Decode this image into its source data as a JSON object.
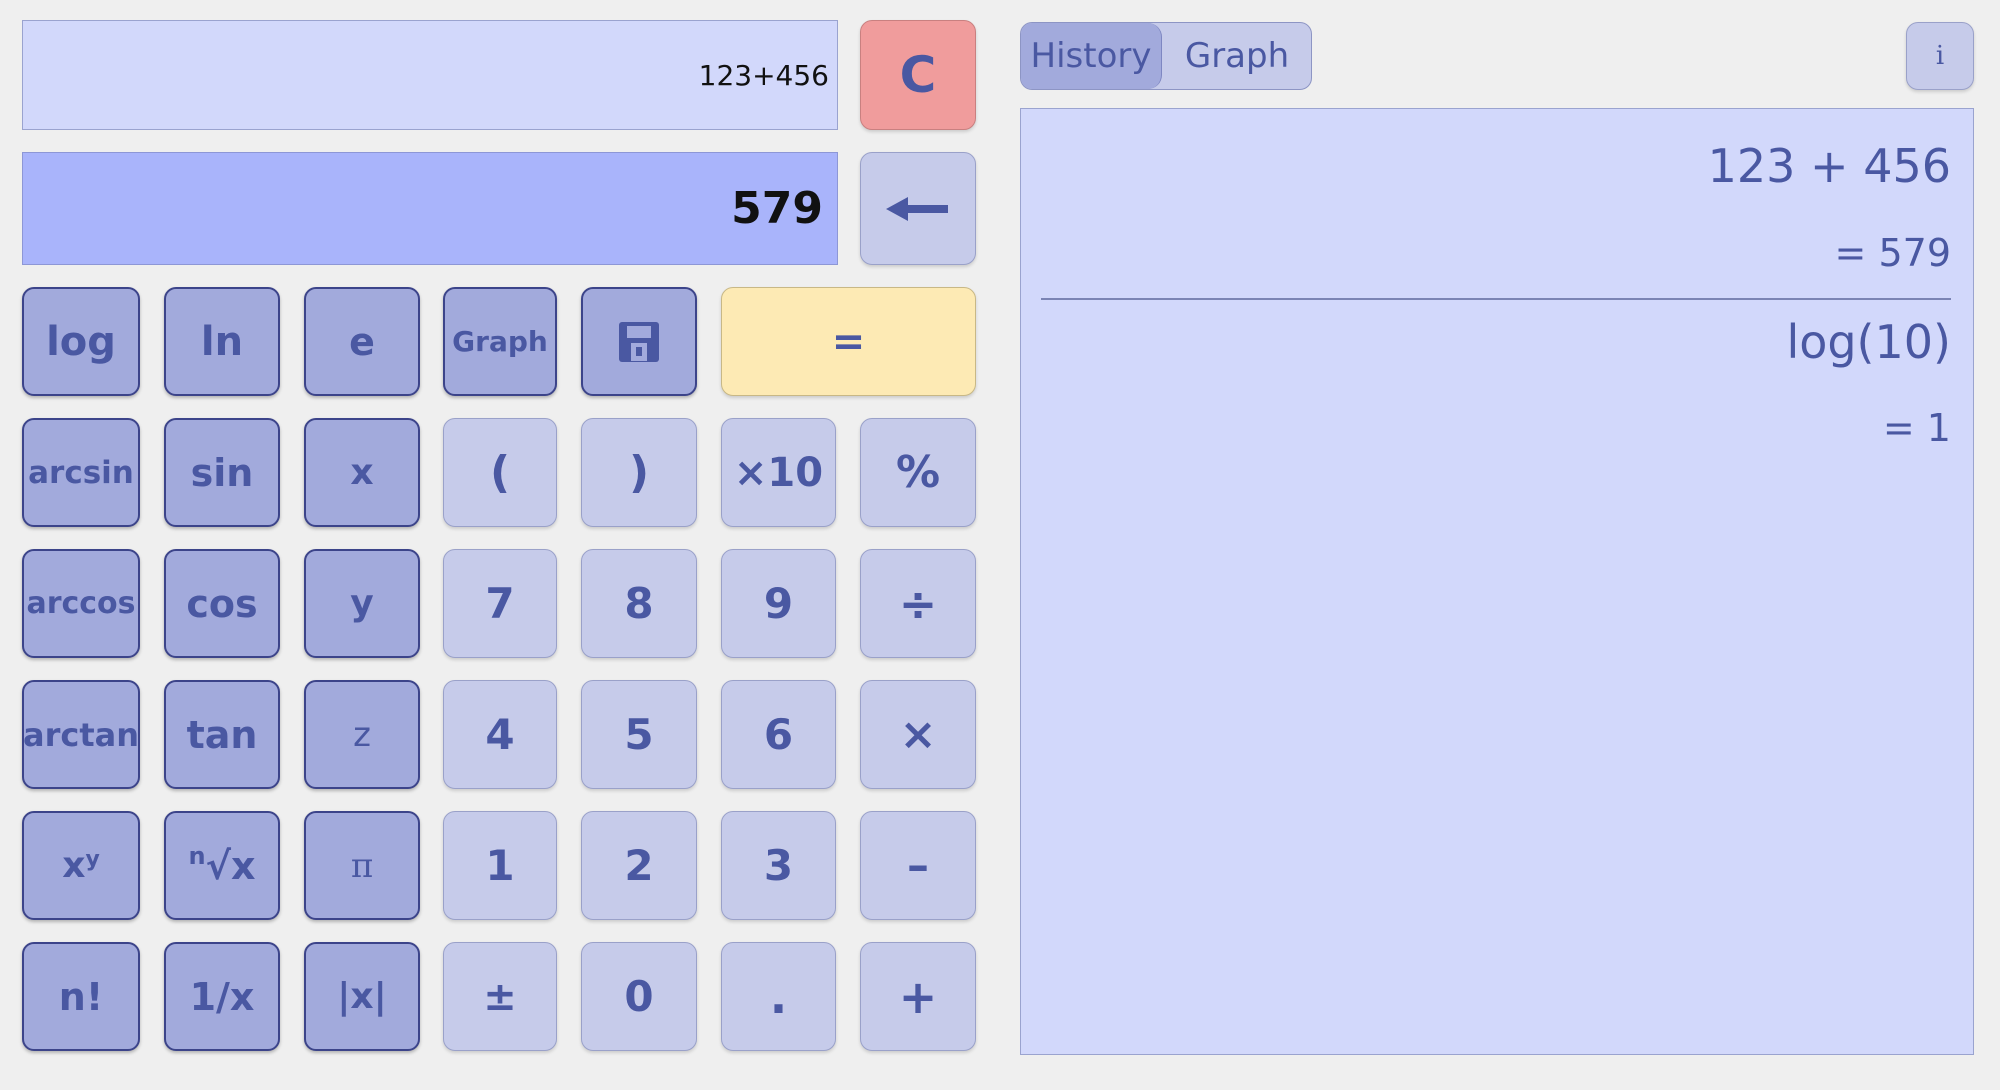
{
  "display": {
    "expression": "123+456",
    "result": "579"
  },
  "buttons": {
    "clear": "C",
    "backspace_icon": "left-arrow-icon",
    "log": "log",
    "ln": "ln",
    "e": "e",
    "graph": "Graph",
    "save_icon": "floppy-disk-icon",
    "equals": "=",
    "arcsin": "arcsin",
    "sin": "sin",
    "x": "x",
    "lparen": "(",
    "rparen": ")",
    "times10": "×10",
    "percent": "%",
    "arccos": "arccos",
    "cos": "cos",
    "y": "y",
    "n7": "7",
    "n8": "8",
    "n9": "9",
    "divide": "÷",
    "arctan": "arctan",
    "tan": "tan",
    "z": "z",
    "n4": "4",
    "n5": "5",
    "n6": "6",
    "multiply": "×",
    "power_base": "x",
    "power_exp": "y",
    "root_index": "n",
    "root_body": "√x",
    "pi": "π",
    "n1": "1",
    "n2": "2",
    "n3": "3",
    "minus": "–",
    "factorial": "n!",
    "reciprocal": "1/x",
    "abs": "|x|",
    "plusminus": "±",
    "n0": "0",
    "decimal": ".",
    "plus": "+"
  },
  "panel": {
    "tabs": [
      "History",
      "Graph"
    ],
    "active_tab": "History",
    "info_label": "i",
    "history": [
      {
        "expression": "123 + 456",
        "result": "= 579"
      },
      {
        "expression": "log(10)",
        "result": "= 1"
      }
    ]
  },
  "colors": {
    "background": "#efefef",
    "display_light": "#d2d8fb",
    "display_result": "#a9b4fb",
    "function_button": "#a2aadc",
    "number_button": "#c6cbea",
    "equals_button": "#fdeab4",
    "clear_button": "#f09c9c",
    "text": "#4a58a2"
  }
}
